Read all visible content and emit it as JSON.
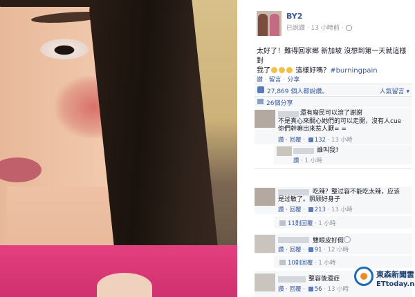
{
  "post": {
    "author": "BY2",
    "meta": "已說讚 · 13 小時前 ·",
    "text_1": "太好了！難得回家鄉 新加坡 沒想到第一天就這樣對",
    "text_2": "我了",
    "text_3": "這樣好嗎？",
    "hashtag": "#burningpain",
    "actions": [
      "讚",
      "留言",
      "分享"
    ],
    "likes": "27,869 個人都說讚。",
    "top_comments": "人氣留言",
    "shares": "26個分享"
  },
  "comments": [
    {
      "text_1": "還有廢民可以滾了謝謝",
      "text_2": "不是真心來關心她們的可以走開，沒有人cue",
      "text_3": "你們幹嘛出來惹人厭= =",
      "actions": "讚 · 回覆 · ",
      "likes": "132",
      "time": " · 13 小時"
    },
    {
      "text_1": "誰叫我?",
      "actions": "讚 · ",
      "time": "1 小時"
    },
    {
      "text_1": "吃辣？整过容不能吃太辣，应该",
      "text_2": "是过敏了。照顾好身子",
      "actions": "讚 · 回覆 · ",
      "likes": "213",
      "time": " · 13 小時"
    },
    {
      "replies": "11則回覆",
      "time": " · 1 小時"
    },
    {
      "text_1": "雙眼皮好假",
      "actions": "讚 · 回覆 · ",
      "likes": "91",
      "time": " · 12 小時"
    },
    {
      "replies": "10則回覆",
      "time": " · 1 小時"
    },
    {
      "text_1": "整容後遺症",
      "actions": "讚 · 回覆 · ",
      "likes": "56",
      "time": " · 13 小時"
    }
  ],
  "watermark": {
    "name": "東森新聞雲",
    "domain": "ETtoday.net"
  },
  "colors": {
    "fb_link": "#3b5998",
    "fb_gray": "#90949c",
    "comment_bg": "#f6f7f9"
  }
}
